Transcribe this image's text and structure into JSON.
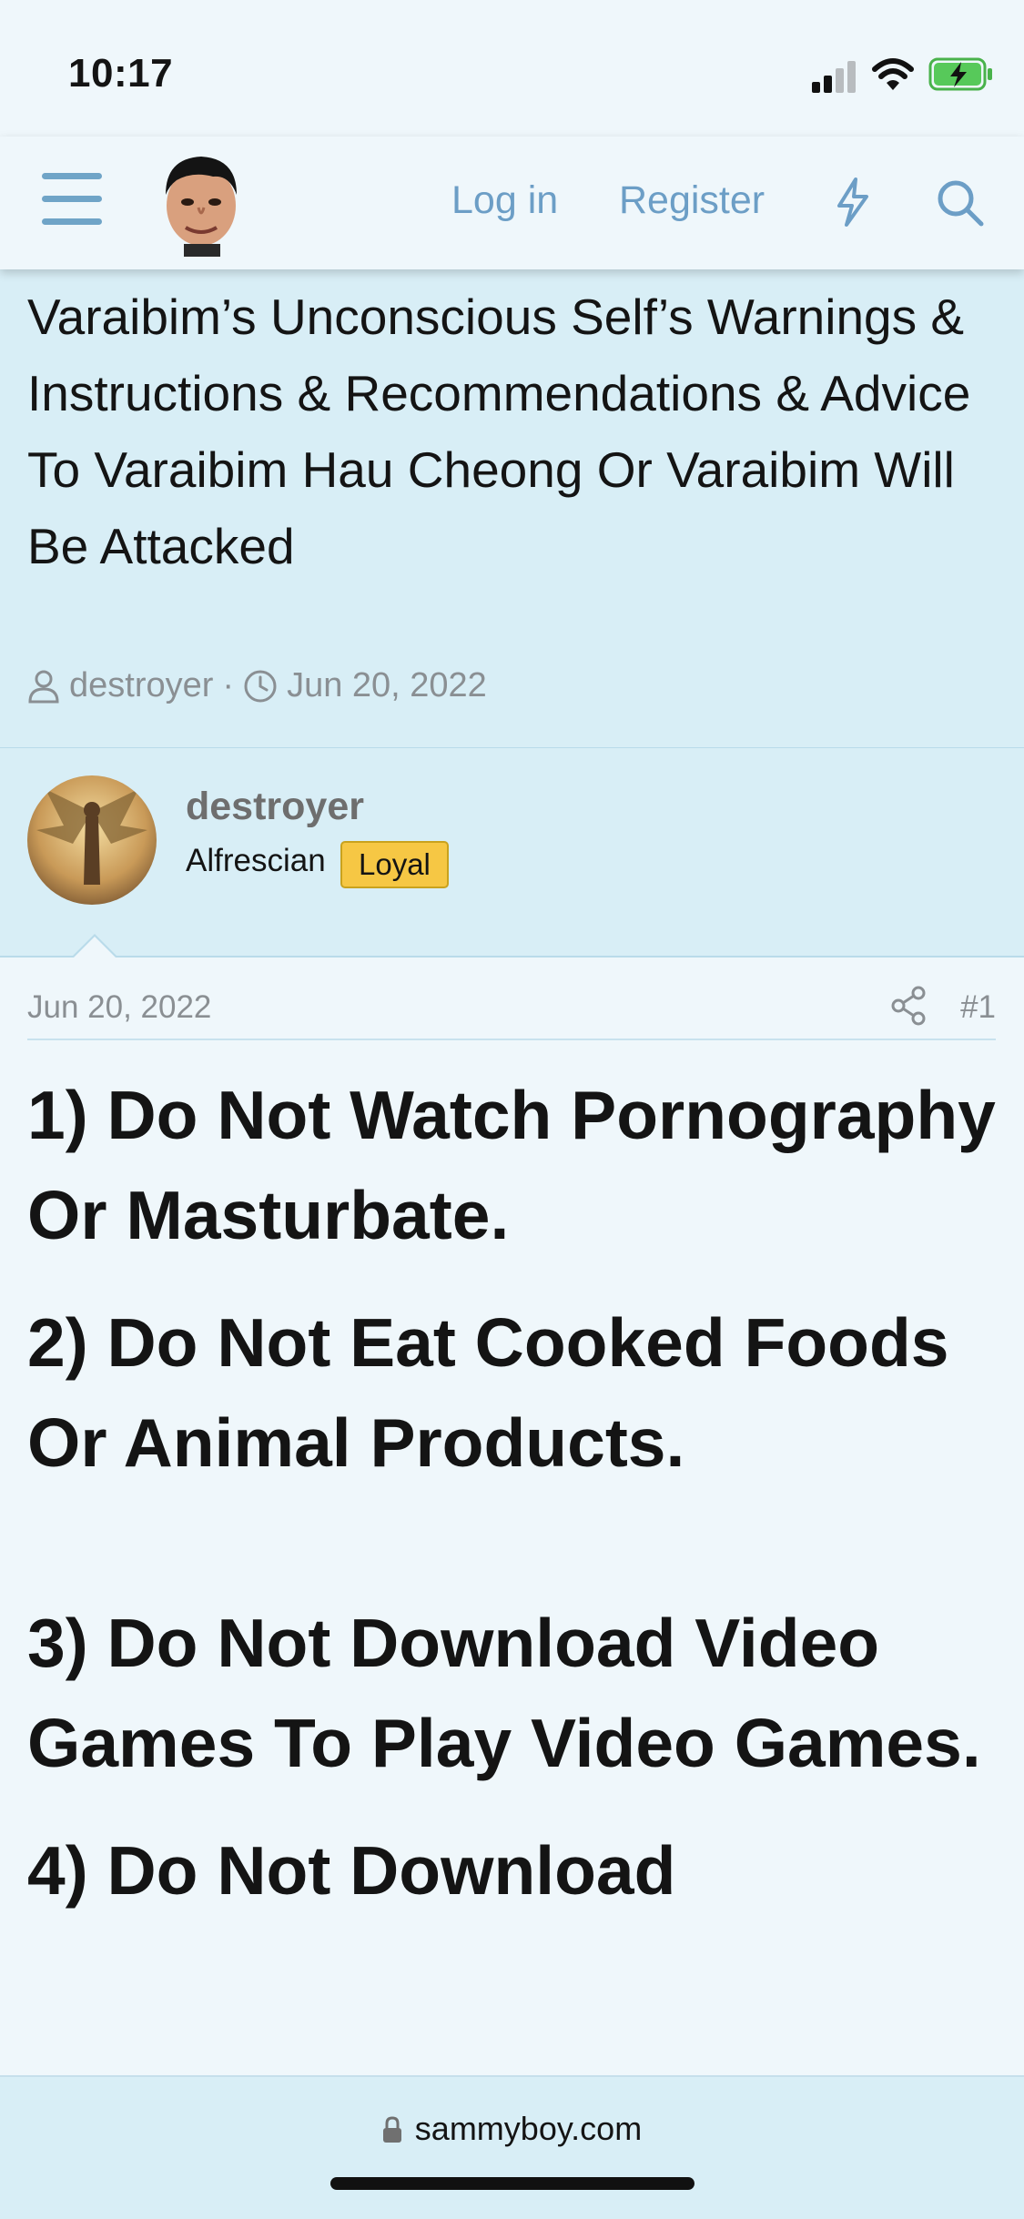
{
  "status": {
    "time": "10:17"
  },
  "nav": {
    "login": "Log in",
    "register": "Register"
  },
  "thread": {
    "title": "Varaibim’s Unconscious Self’s Warnings & Instructions & Recommendations & Advice To Varaibim Hau Cheong Or Varaibim Will Be Attacked",
    "author": "destroyer",
    "separator": "·",
    "date": "Jun 20, 2022"
  },
  "author": {
    "name": "destroyer",
    "title": "Alfrescian",
    "badge": "Loyal"
  },
  "post": {
    "date": "Jun 20, 2022",
    "number": "#1",
    "lines": [
      "1) Do Not Watch Pornography Or Masturbate.",
      "2) Do Not Eat Cooked Foods Or Animal Products.",
      "3) Do Not Download Video Games To Play Video Games.",
      "4) Do Not Download"
    ]
  },
  "browser": {
    "url": "sammyboy.com"
  },
  "colors": {
    "accent": "#6c9ec6",
    "header_bg": "#d8eef6",
    "badge": "#f6c744",
    "page_bg": "#eff7fb"
  }
}
